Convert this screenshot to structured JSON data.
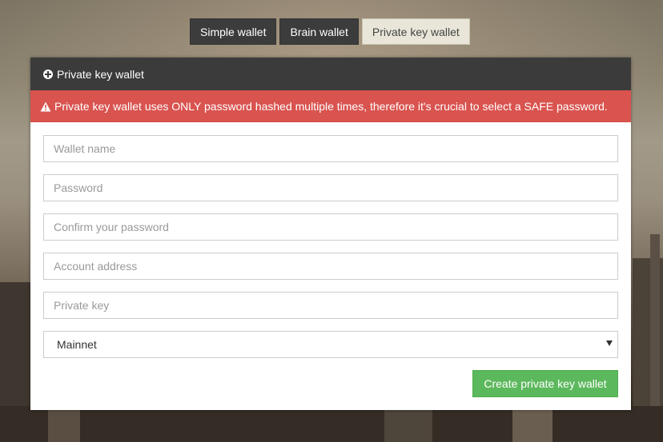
{
  "tabs": [
    {
      "label": "Simple wallet",
      "active": false
    },
    {
      "label": "Brain wallet",
      "active": false
    },
    {
      "label": "Private key wallet",
      "active": true
    }
  ],
  "panel": {
    "title": "Private key wallet",
    "title_icon": "plus-circle-icon",
    "alert": {
      "icon": "warning-icon",
      "text": "Private key wallet uses ONLY password hashed multiple times, therefore it's crucial to select a SAFE password."
    },
    "fields": {
      "wallet_name": {
        "placeholder": "Wallet name",
        "value": ""
      },
      "password": {
        "placeholder": "Password",
        "value": ""
      },
      "confirm_password": {
        "placeholder": "Confirm your password",
        "value": ""
      },
      "account_address": {
        "placeholder": "Account address",
        "value": ""
      },
      "private_key": {
        "placeholder": "Private key",
        "value": ""
      }
    },
    "network_select": {
      "selected": "Mainnet"
    },
    "create_button": "Create private key wallet"
  },
  "colors": {
    "header_bg": "#3b3b3b",
    "alert_bg": "#d9534f",
    "button_green": "#5cb85c",
    "active_tab_bg": "#e9e6d9"
  }
}
